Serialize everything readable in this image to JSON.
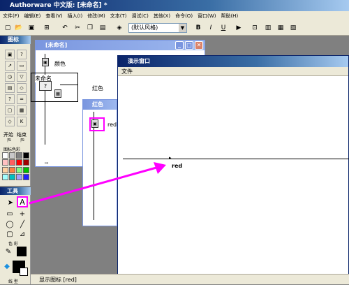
{
  "app": {
    "title": "Authorware 中文版: [未命名] *"
  },
  "menu": [
    "文件(F)",
    "编辑(E)",
    "查看(V)",
    "插入(I)",
    "修改(M)",
    "文本(T)",
    "调试(C)",
    "其他(X)",
    "命令(O)",
    "窗口(W)",
    "帮助(H)"
  ],
  "toolbar": {
    "style_select": "(默认风格)",
    "bold": "B",
    "italic": "I",
    "underline": "U"
  },
  "icon_palette": {
    "title": "图标",
    "start_label": "开始",
    "end_label": "结束",
    "color_label": "图标色彩",
    "swatches": [
      "#ffffff",
      "#c8c8c8",
      "#808080",
      "#000000",
      "#ffc0c0",
      "#ff6060",
      "#ff0000",
      "#a00000",
      "#ffd0a0",
      "#ff8040",
      "#80ff80",
      "#00c000",
      "#a0ffff",
      "#00c0c0",
      "#a0a0ff",
      "#2020ff"
    ]
  },
  "tools_panel": {
    "title": "工具",
    "color_label": "色 彩",
    "line_label": "线 型"
  },
  "flow_window": {
    "title": "[未命名]",
    "icon1_label": "颜色",
    "map_label": "未命名",
    "red_label": "红色"
  },
  "sub_flow_window": {
    "title": "红色",
    "icon_label": "red"
  },
  "presentation_window": {
    "title": "演示窗口",
    "menu_file": "文件",
    "text": "red"
  },
  "status_bar": {
    "text": "显示图标 [red]"
  },
  "colors": {
    "accent": "#ff00ff",
    "titlebar": "#0a246a"
  }
}
